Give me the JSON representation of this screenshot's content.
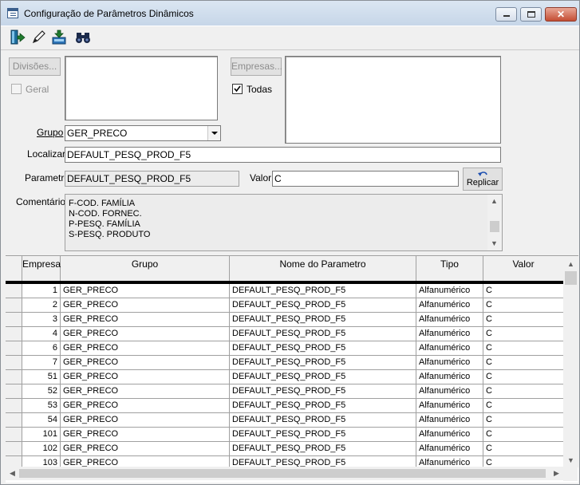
{
  "window": {
    "title": "Configuração de Parâmetros Dinâmicos",
    "close_glyph": "✕"
  },
  "toolbar": {
    "icons": [
      "exit-door-icon",
      "pencil-icon",
      "save-icon",
      "binoculars-icon"
    ]
  },
  "form": {
    "divisoes_button": "Divisões...",
    "geral_label": "Geral",
    "geral_checked": false,
    "empresas_button": "Empresas...",
    "todas_label": "Todas",
    "todas_checked": true,
    "grupo_label": "Grupo",
    "grupo_value": "GER_PRECO",
    "localizar_label": "Localizar",
    "localizar_value": "DEFAULT_PESQ_PROD_F5",
    "parametro_label": "Parametro",
    "parametro_value": "DEFAULT_PESQ_PROD_F5",
    "valor_label": "Valor",
    "valor_value": "C",
    "replicar_button": "Replicar",
    "comentarios_label": "Comentários",
    "comentarios_lines": [
      "F-COD. FAMÍLIA",
      "N-COD. FORNEC.",
      "P-PESQ. FAMÍLIA",
      "S-PESQ. PRODUTO"
    ]
  },
  "grid": {
    "columns": [
      "Empresa",
      "Grupo",
      "Nome do Parametro",
      "Tipo",
      "Valor"
    ],
    "rows": [
      [
        "1",
        "GER_PRECO",
        "DEFAULT_PESQ_PROD_F5",
        "Alfanumérico",
        "C"
      ],
      [
        "2",
        "GER_PRECO",
        "DEFAULT_PESQ_PROD_F5",
        "Alfanumérico",
        "C"
      ],
      [
        "3",
        "GER_PRECO",
        "DEFAULT_PESQ_PROD_F5",
        "Alfanumérico",
        "C"
      ],
      [
        "4",
        "GER_PRECO",
        "DEFAULT_PESQ_PROD_F5",
        "Alfanumérico",
        "C"
      ],
      [
        "6",
        "GER_PRECO",
        "DEFAULT_PESQ_PROD_F5",
        "Alfanumérico",
        "C"
      ],
      [
        "7",
        "GER_PRECO",
        "DEFAULT_PESQ_PROD_F5",
        "Alfanumérico",
        "C"
      ],
      [
        "51",
        "GER_PRECO",
        "DEFAULT_PESQ_PROD_F5",
        "Alfanumérico",
        "C"
      ],
      [
        "52",
        "GER_PRECO",
        "DEFAULT_PESQ_PROD_F5",
        "Alfanumérico",
        "C"
      ],
      [
        "53",
        "GER_PRECO",
        "DEFAULT_PESQ_PROD_F5",
        "Alfanumérico",
        "C"
      ],
      [
        "54",
        "GER_PRECO",
        "DEFAULT_PESQ_PROD_F5",
        "Alfanumérico",
        "C"
      ],
      [
        "101",
        "GER_PRECO",
        "DEFAULT_PESQ_PROD_F5",
        "Alfanumérico",
        "C"
      ],
      [
        "102",
        "GER_PRECO",
        "DEFAULT_PESQ_PROD_F5",
        "Alfanumérico",
        "C"
      ],
      [
        "103",
        "GER_PRECO",
        "DEFAULT_PESQ_PROD_F5",
        "Alfanumérico",
        "C"
      ]
    ]
  },
  "colors": {
    "window_bg": "#f0f0f0",
    "grid_line": "#a0a0a0",
    "readonly_bg": "#ececec",
    "replicar_icon": "#1d4fb0"
  }
}
